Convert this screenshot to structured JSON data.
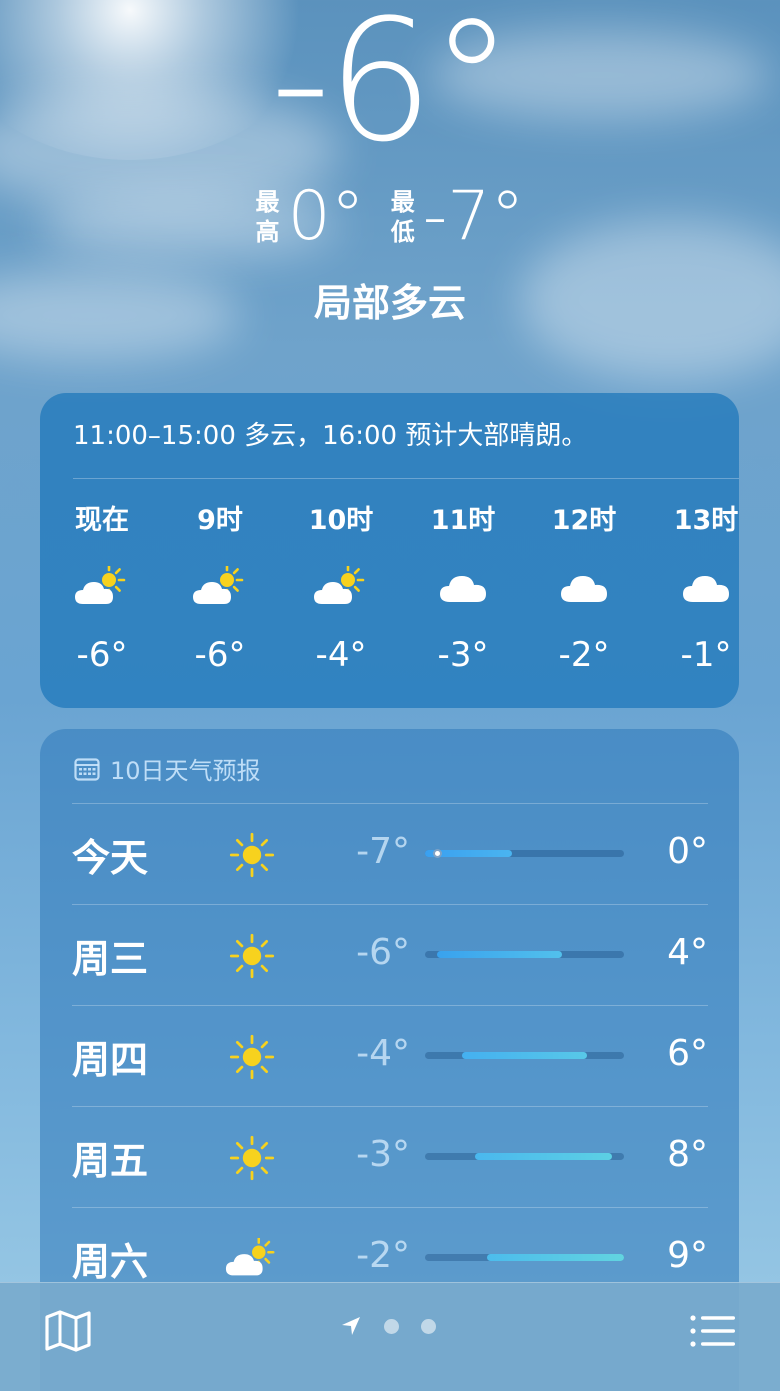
{
  "hero": {
    "current_temp": "-6°",
    "high_label_1": "最",
    "high_label_2": "高",
    "high_value": "0°",
    "low_label_1": "最",
    "low_label_2": "低",
    "low_value": "-7°",
    "condition": "局部多云"
  },
  "hourly": {
    "summary": "11:00–15:00 多云，16:00 预计大部晴朗。",
    "items": [
      {
        "label": "现在",
        "icon": "partly-cloudy-day-icon",
        "temp": "-6°"
      },
      {
        "label": "9时",
        "icon": "partly-cloudy-day-icon",
        "temp": "-6°"
      },
      {
        "label": "10时",
        "icon": "partly-cloudy-day-icon",
        "temp": "-4°"
      },
      {
        "label": "11时",
        "icon": "cloud-icon",
        "temp": "-3°"
      },
      {
        "label": "12时",
        "icon": "cloud-icon",
        "temp": "-2°"
      },
      {
        "label": "13时",
        "icon": "cloud-icon",
        "temp": "-1°"
      }
    ]
  },
  "daily": {
    "header": "10日天气预报",
    "header_icon": "calendar-icon",
    "range_min": -7,
    "range_max": 9,
    "current_temp_value": -6,
    "days": [
      {
        "name": "今天",
        "icon": "sun-icon",
        "low": "-7°",
        "high": "0°",
        "low_value": -7,
        "high_value": 0,
        "show_current": true,
        "colors": [
          "#3aa0f0",
          "#4ab4f0"
        ]
      },
      {
        "name": "周三",
        "icon": "sun-icon",
        "low": "-6°",
        "high": "4°",
        "low_value": -6,
        "high_value": 4,
        "show_current": false,
        "colors": [
          "#39a2ee",
          "#52c0ec"
        ]
      },
      {
        "name": "周四",
        "icon": "sun-icon",
        "low": "-4°",
        "high": "6°",
        "low_value": -4,
        "high_value": 6,
        "show_current": false,
        "colors": [
          "#44b0f0",
          "#58c8e8"
        ]
      },
      {
        "name": "周五",
        "icon": "sun-icon",
        "low": "-3°",
        "high": "8°",
        "low_value": -3,
        "high_value": 8,
        "show_current": false,
        "colors": [
          "#4ab8ee",
          "#5cd0e4"
        ]
      },
      {
        "name": "周六",
        "icon": "partly-cloudy-day-icon",
        "low": "-2°",
        "high": "9°",
        "low_value": -2,
        "high_value": 9,
        "show_current": false,
        "colors": [
          "#4cbcec",
          "#62d4e0"
        ]
      }
    ]
  },
  "bottom": {
    "map_icon": "map-icon",
    "location_icon": "location-arrow-icon",
    "list_icon": "list-icon",
    "page_count": 3
  },
  "colors": {
    "sun": "#f7d21e",
    "cloud": "#ffffff"
  }
}
